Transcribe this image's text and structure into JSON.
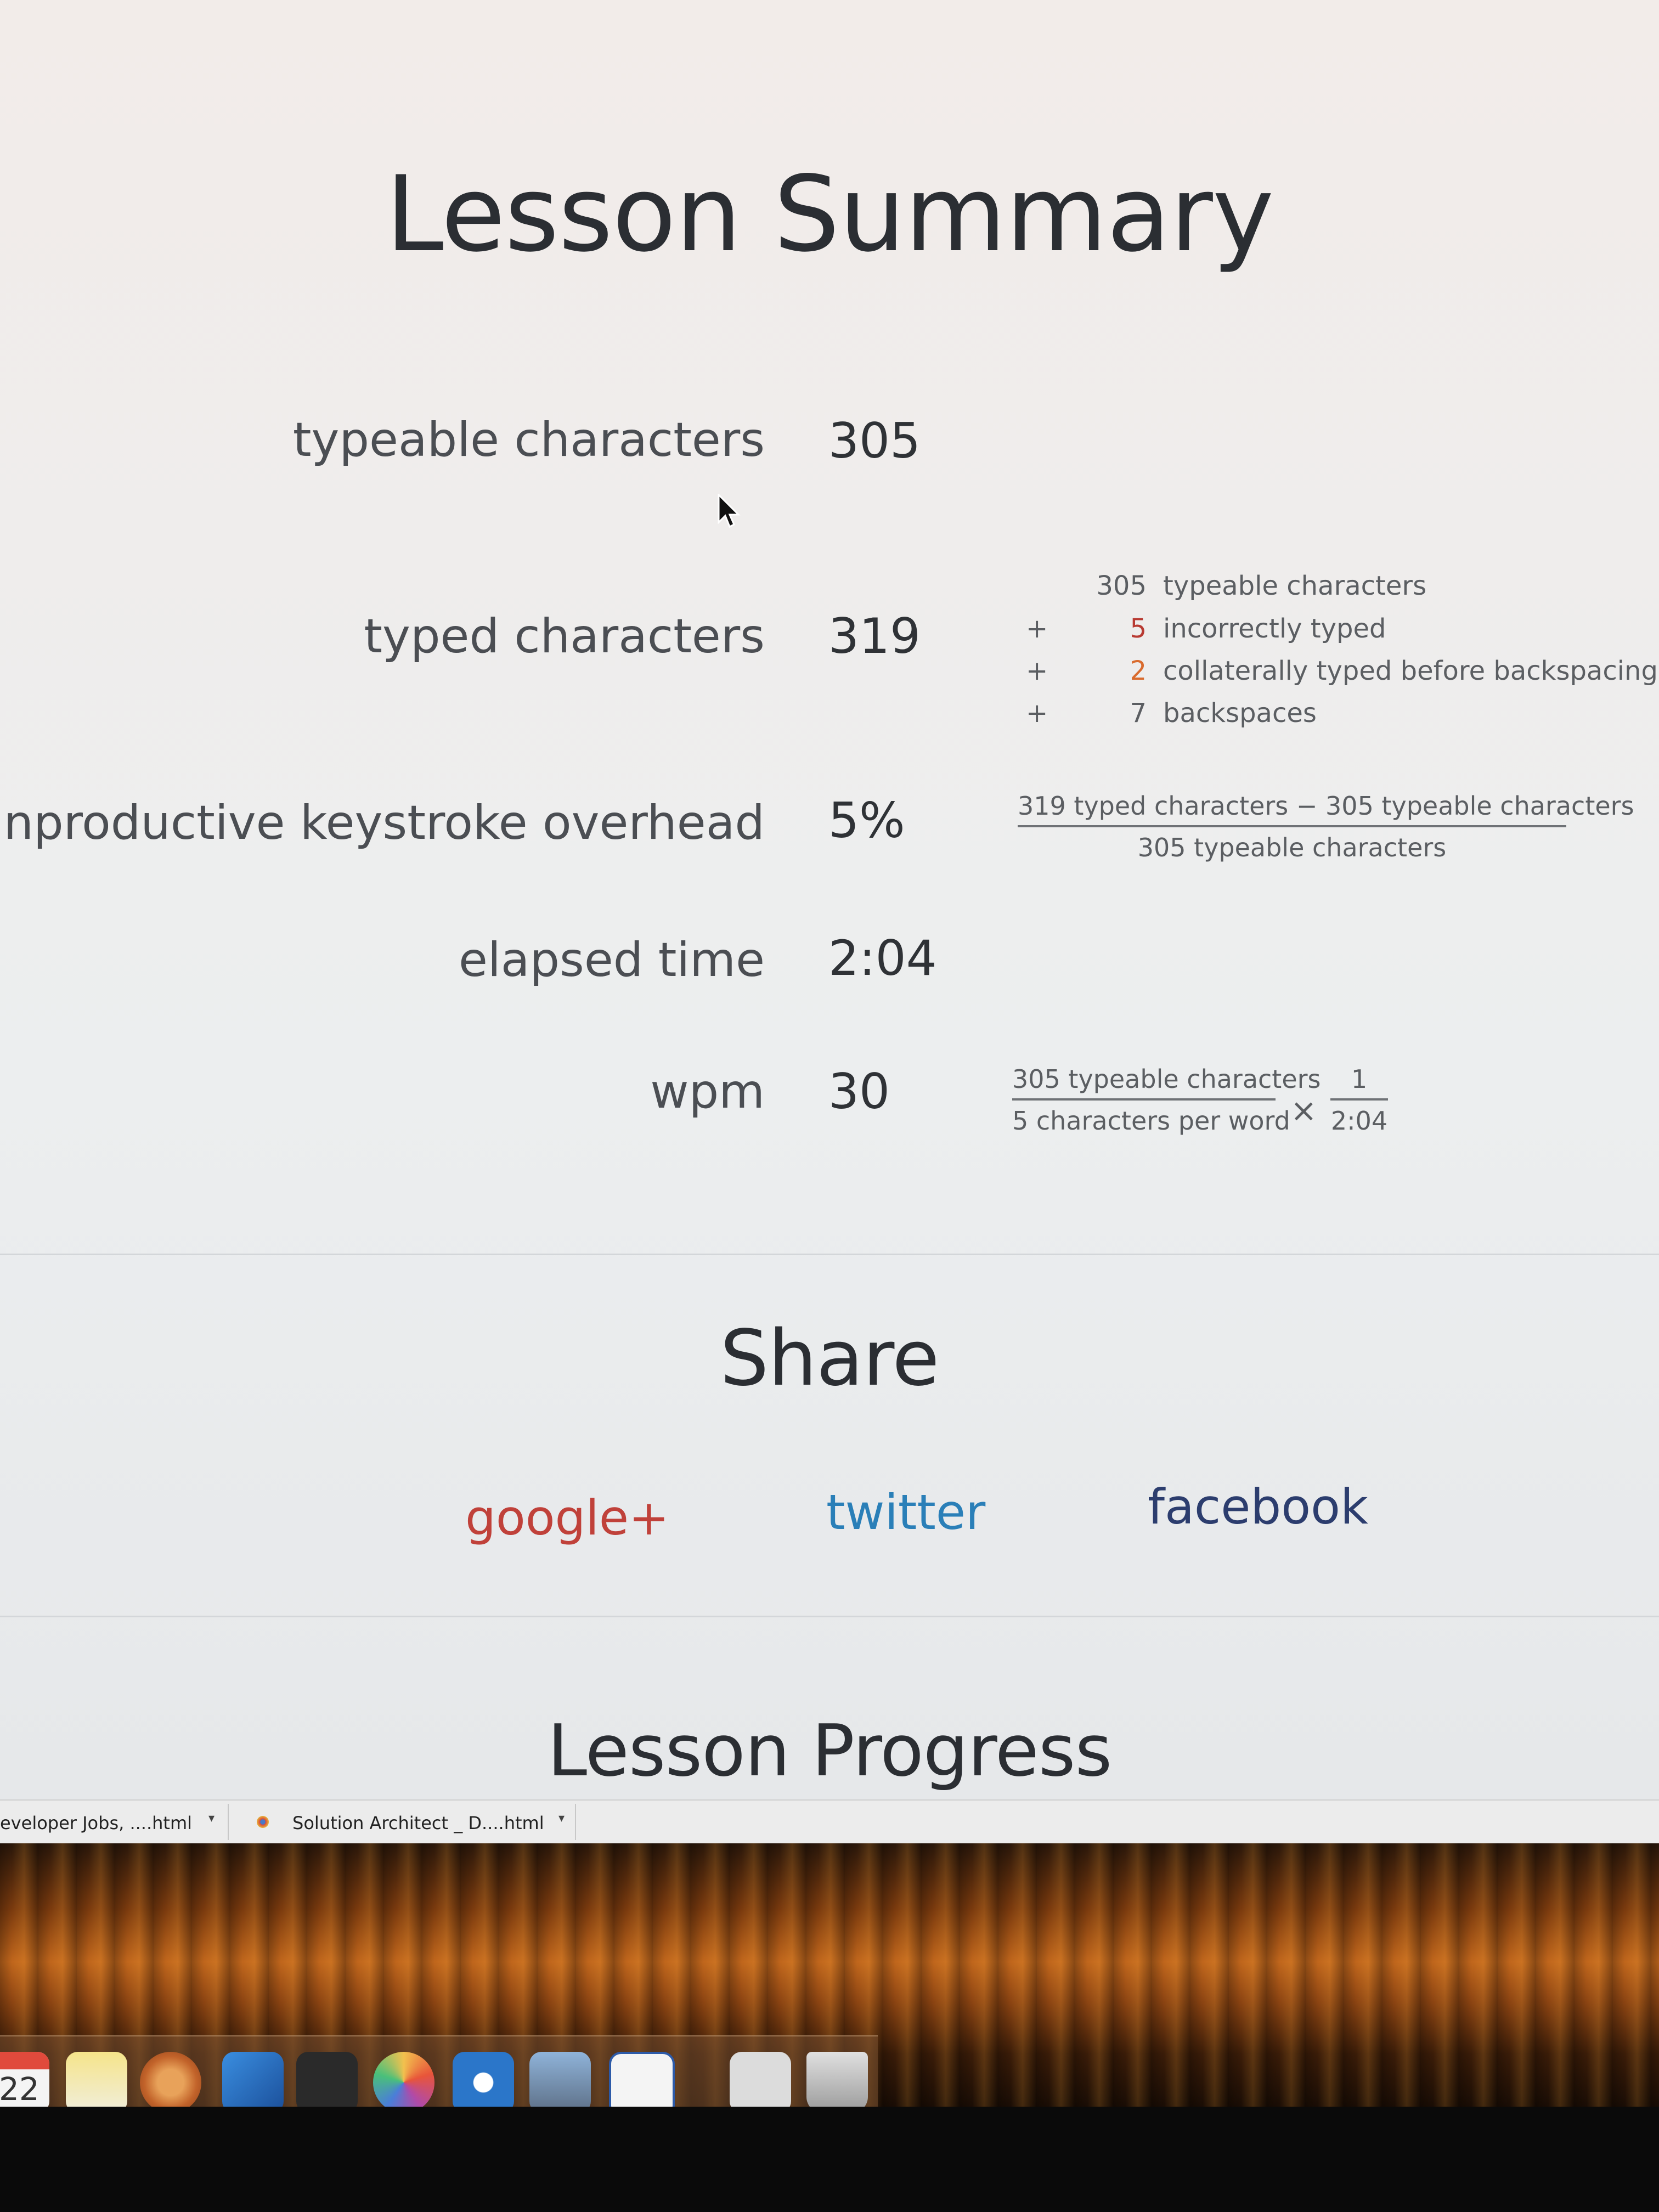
{
  "lesson_summary": {
    "title": "Lesson Summary",
    "typeable_characters": {
      "label": "typeable characters",
      "value": "305"
    },
    "typed_characters": {
      "label": "typed characters",
      "value": "319",
      "breakdown": [
        {
          "op": "",
          "num": "305",
          "text": "typeable characters"
        },
        {
          "op": "+",
          "num": "5",
          "text": "incorrectly typed"
        },
        {
          "op": "+",
          "num": "2",
          "text": "collaterally typed before backspacing"
        },
        {
          "op": "+",
          "num": "7",
          "text": "backspaces"
        }
      ]
    },
    "overhead": {
      "label": "unproductive keystroke overhead",
      "value": "5%",
      "numerator": "319 typed characters − 305 typeable characters",
      "denominator": "305 typeable characters"
    },
    "elapsed_time": {
      "label": "elapsed time",
      "value": "2:04"
    },
    "wpm": {
      "label": "wpm",
      "value": "30",
      "frac1_numerator": "305 typeable characters",
      "frac1_denominator": "5 characters per word",
      "times": "×",
      "frac2_numerator": "1",
      "frac2_denominator": "2:04"
    }
  },
  "share": {
    "title": "Share",
    "google": "google+",
    "twitter": "twitter",
    "facebook": "facebook"
  },
  "lesson_progress": {
    "title": "Lesson Progress"
  },
  "downloads": [
    {
      "name": "eveloper Jobs, ....html"
    },
    {
      "name": "Solution Architect _ D....html"
    }
  ],
  "dock": {
    "calendar_day": "22"
  },
  "colors": {
    "google": "#c0413a",
    "twitter": "#2a7fb8",
    "facebook": "#2c3d6e",
    "incorrect": "#b83a32",
    "collateral": "#d96b2e"
  }
}
